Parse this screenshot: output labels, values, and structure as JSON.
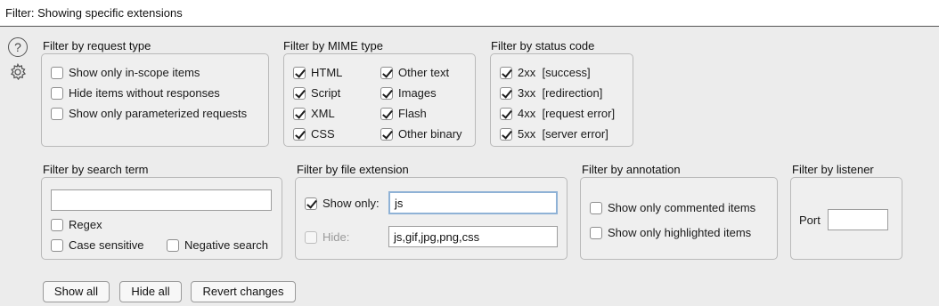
{
  "header": {
    "title": "Filter: Showing specific extensions"
  },
  "sidebar": {
    "help_symbol": "?",
    "icons": [
      "help-icon",
      "gear-icon"
    ]
  },
  "request_type": {
    "title": "Filter by request type",
    "items": [
      {
        "label": "Show only in-scope items",
        "checked": false
      },
      {
        "label": "Hide items without responses",
        "checked": false
      },
      {
        "label": "Show only parameterized requests",
        "checked": false
      }
    ]
  },
  "mime_type": {
    "title": "Filter by MIME type",
    "items": [
      {
        "label": "HTML",
        "checked": true
      },
      {
        "label": "Script",
        "checked": true
      },
      {
        "label": "XML",
        "checked": true
      },
      {
        "label": "CSS",
        "checked": true
      },
      {
        "label": "Other text",
        "checked": true
      },
      {
        "label": "Images",
        "checked": true
      },
      {
        "label": "Flash",
        "checked": true
      },
      {
        "label": "Other binary",
        "checked": true
      }
    ]
  },
  "status_code": {
    "title": "Filter by status code",
    "items": [
      {
        "label": "2xx  [success]",
        "checked": true
      },
      {
        "label": "3xx  [redirection]",
        "checked": true
      },
      {
        "label": "4xx  [request error]",
        "checked": true
      },
      {
        "label": "5xx  [server error]",
        "checked": true
      }
    ]
  },
  "search_term": {
    "title": "Filter by search term",
    "value": "",
    "regex": {
      "label": "Regex",
      "checked": false
    },
    "case_sensitive": {
      "label": "Case sensitive",
      "checked": false
    },
    "negative": {
      "label": "Negative search",
      "checked": false
    }
  },
  "file_extension": {
    "title": "Filter by file extension",
    "show_only": {
      "label": "Show only:",
      "checked": true,
      "value": "js"
    },
    "hide": {
      "label": "Hide:",
      "checked": false,
      "disabled": true,
      "value": "js,gif,jpg,png,css"
    }
  },
  "annotation": {
    "title": "Filter by annotation",
    "items": [
      {
        "label": "Show only commented items",
        "checked": false
      },
      {
        "label": "Show only highlighted items",
        "checked": false
      }
    ]
  },
  "listener": {
    "title": "Filter by listener",
    "port_label": "Port",
    "port_value": ""
  },
  "buttons": {
    "show_all": "Show all",
    "hide_all": "Hide all",
    "revert": "Revert changes"
  },
  "colors": {
    "background": "#ececec",
    "focus_border": "#8fb2d6"
  }
}
